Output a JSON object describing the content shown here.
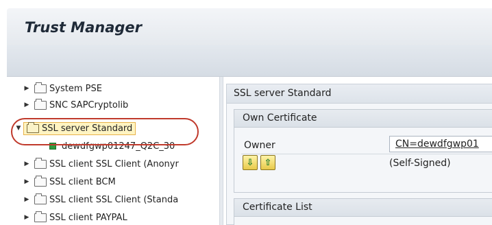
{
  "app": {
    "title": "Trust Manager"
  },
  "tree": {
    "items": [
      {
        "label": "System PSE",
        "arrow": "▶"
      },
      {
        "label": "SNC SAPCryptolib",
        "arrow": "▶"
      },
      {
        "label": "SSL server Standard",
        "arrow": "▼"
      },
      {
        "label": "dewdfgwp01247_Q2C_30"
      },
      {
        "label": "SSL client SSL Client (Anonyr",
        "arrow": "▶"
      },
      {
        "label": "SSL client BCM",
        "arrow": "▶"
      },
      {
        "label": "SSL client SSL Client (Standa",
        "arrow": "▶"
      },
      {
        "label": "SSL client PAYPAL",
        "arrow": "▶"
      }
    ]
  },
  "detail": {
    "header": "SSL server Standard",
    "own_certificate": {
      "title": "Own Certificate",
      "owner_label": "Owner",
      "owner_value": "CN=dewdfgwp01",
      "status": "(Self-Signed)",
      "buttons": [
        {
          "icon": "import-certificate-icon",
          "glyph": "⇩"
        },
        {
          "icon": "export-certificate-icon",
          "glyph": "⇧"
        }
      ]
    },
    "certificate_list": {
      "title": "Certificate List"
    }
  },
  "colors": {
    "highlight_ring": "#c0392b",
    "selected_background": "#fff4c2",
    "certificate_green": "#2e9b3e"
  }
}
